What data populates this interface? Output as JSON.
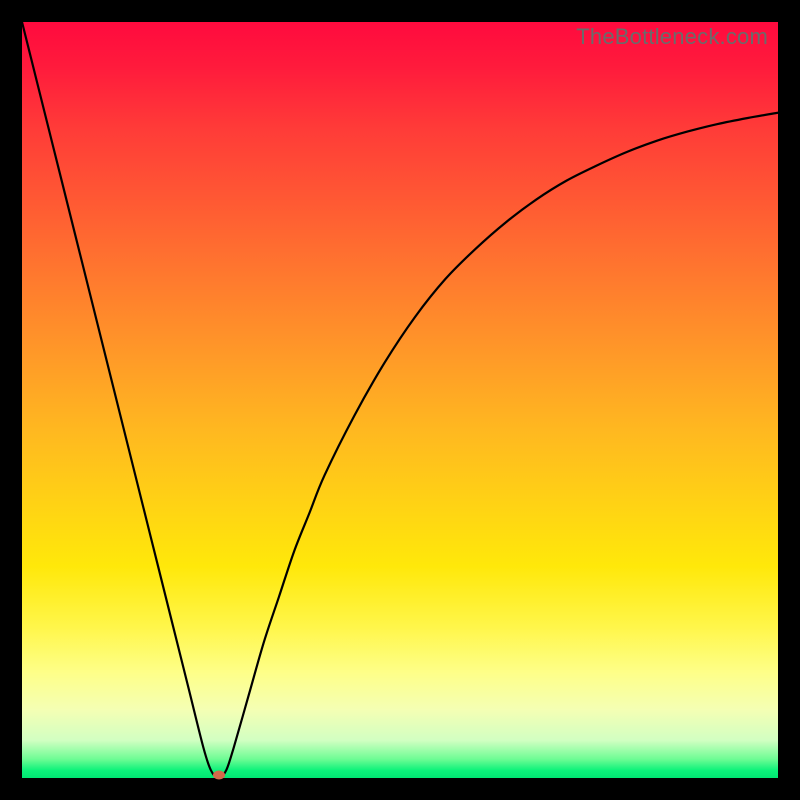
{
  "watermark": "TheBottleneck.com",
  "colors": {
    "frame": "#000000",
    "curve": "#000000",
    "marker": "#d36a4a",
    "gradient_top": "#ff0a3e",
    "gradient_bottom": "#00e673"
  },
  "chart_data": {
    "type": "line",
    "title": "",
    "xlabel": "",
    "ylabel": "",
    "xlim": [
      0,
      100
    ],
    "ylim": [
      0,
      100
    ],
    "grid": false,
    "legend": false,
    "annotations": [],
    "series": [
      {
        "name": "bottleneck-curve",
        "x": [
          0,
          2,
          4,
          6,
          8,
          10,
          12,
          14,
          16,
          18,
          20,
          22,
          24,
          25,
          26,
          27,
          28,
          30,
          32,
          34,
          36,
          38,
          40,
          44,
          48,
          52,
          56,
          60,
          64,
          68,
          72,
          76,
          80,
          84,
          88,
          92,
          96,
          100
        ],
        "y": [
          100,
          92,
          84,
          76,
          68,
          60,
          52,
          44,
          36,
          28,
          20,
          12,
          4,
          1,
          0,
          1,
          4,
          11,
          18,
          24,
          30,
          35,
          40,
          48,
          55,
          61,
          66,
          70,
          73.5,
          76.5,
          79,
          81,
          82.8,
          84.3,
          85.5,
          86.5,
          87.3,
          88
        ]
      }
    ],
    "marker": {
      "x": 26,
      "y": 0
    }
  }
}
